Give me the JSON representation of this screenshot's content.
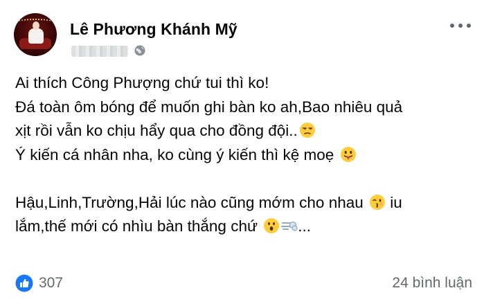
{
  "author": {
    "name": "Lê Phương Khánh Mỹ",
    "avatar_icon": "profile-photo",
    "privacy_icon": "globe-icon"
  },
  "post": {
    "lines": [
      "Ai thích Công Phượng chứ tui thì ko!",
      "Đá toàn ôm bóng để muốn ghi bàn ko ah,Bao nhiêu quả",
      "xịt rồi vẫn ko chịu hẩy qua cho đồng đội..",
      "Ý kiến cá nhân nha, ko cùng ý kiến thì kệ moẹ ",
      "",
      "Hậu,Linh,Trường,Hải lúc nào cũng mớm cho nhau ",
      "lắm,thế mới có nhìu bàn thắng chứ ",
      "..."
    ],
    "line6_tail": " iu",
    "emojis": [
      "unamused-face",
      "face-with-tongue",
      "kissing-face",
      "hushed-face",
      "dash-symbol"
    ]
  },
  "footer": {
    "like_count": "307",
    "comment_count": "24 bình luận"
  },
  "colors": {
    "like_blue": "#1877f2",
    "secondary_text": "#65676b",
    "emoji_yellow": "#ffcc3e"
  }
}
